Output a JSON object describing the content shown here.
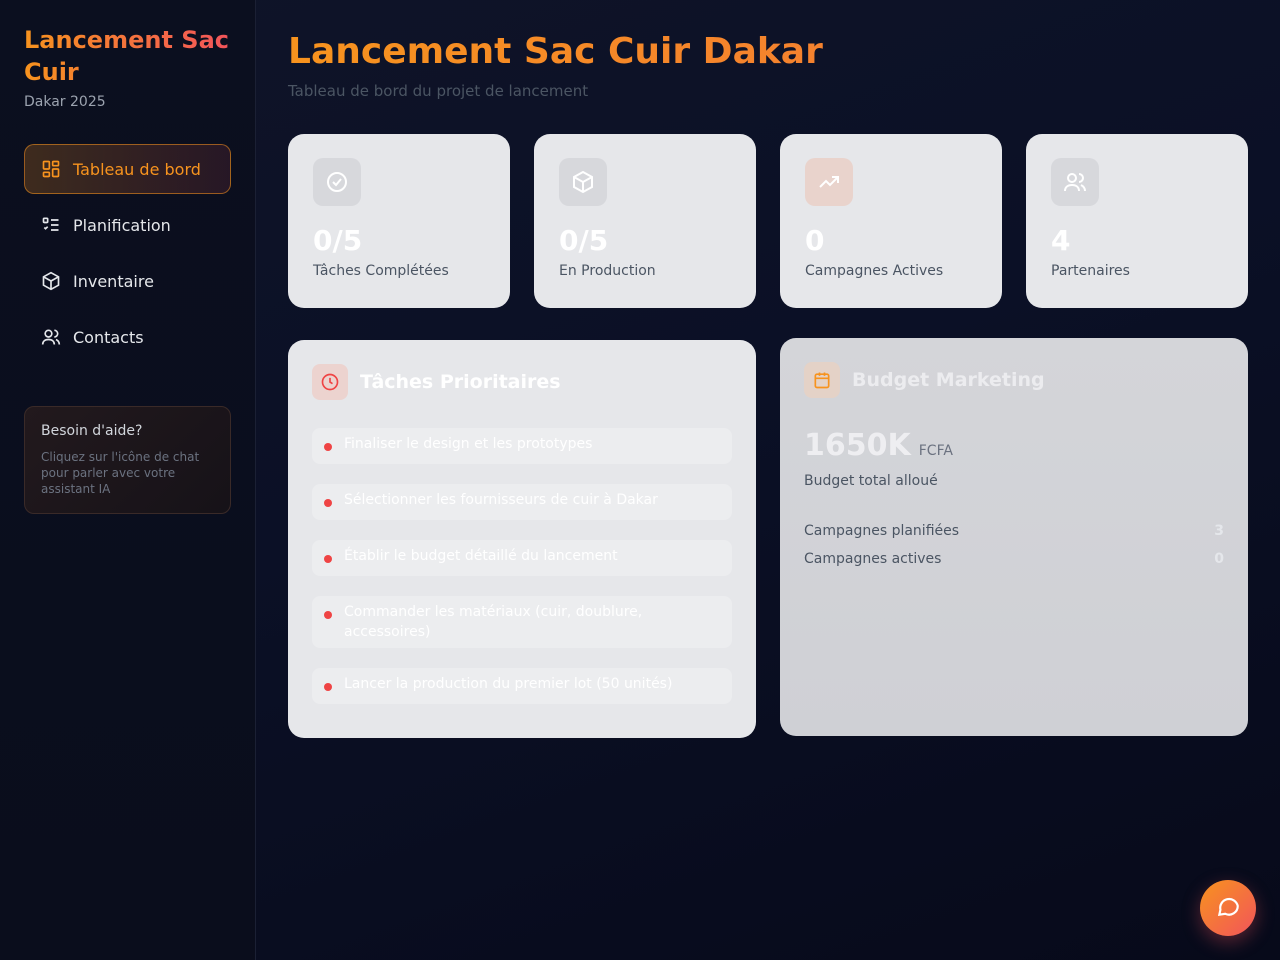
{
  "brand": {
    "title": "Lancement Sac Cuir",
    "subtitle": "Dakar 2025"
  },
  "nav": [
    {
      "label": "Tableau de bord",
      "icon": "dashboard-icon",
      "active": true
    },
    {
      "label": "Planification",
      "icon": "checklist-icon",
      "active": false
    },
    {
      "label": "Inventaire",
      "icon": "package-icon",
      "active": false
    },
    {
      "label": "Contacts",
      "icon": "users-icon",
      "active": false
    }
  ],
  "help": {
    "title": "Besoin d'aide?",
    "text": "Cliquez sur l'icône de chat pour parler avec votre assistant IA"
  },
  "header": {
    "title": "Lancement Sac Cuir Dakar",
    "subtitle": "Tableau de bord du projet de lancement"
  },
  "stats": [
    {
      "value": "0/5",
      "label": "Tâches Complétées",
      "icon": "check-circle-icon"
    },
    {
      "value": "0/5",
      "label": "En Production",
      "icon": "box-icon"
    },
    {
      "value": "0",
      "label": "Campagnes Actives",
      "icon": "trending-up-icon"
    },
    {
      "value": "4",
      "label": "Partenaires",
      "icon": "users-icon"
    }
  ],
  "tasks_panel": {
    "title": "Tâches Prioritaires",
    "icon": "clock-icon",
    "items": [
      "Finaliser le design et les prototypes",
      "Sélectionner les fournisseurs de cuir à Dakar",
      "Établir le budget détaillé du lancement",
      "Commander les matériaux (cuir, doublure, accessoires)",
      "Lancer la production du premier lot (50 unités)"
    ]
  },
  "budget_panel": {
    "title": "Budget Marketing",
    "icon": "calendar-icon",
    "amount": "1650K",
    "currency": "FCFA",
    "amount_label": "Budget total alloué",
    "rows": [
      {
        "label": "Campagnes planifiées",
        "value": "3"
      },
      {
        "label": "Campagnes actives",
        "value": "0"
      }
    ]
  },
  "colors": {
    "accent": "#f7931e",
    "accent2": "#f2545b",
    "bg": "#0b1026"
  },
  "chat_button": {
    "icon": "chat-icon"
  }
}
